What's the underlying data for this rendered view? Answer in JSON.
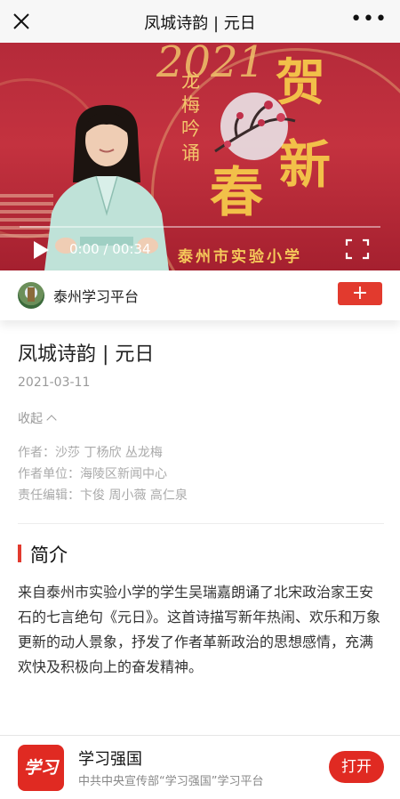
{
  "topbar": {
    "title": "凤城诗韵 | 元日",
    "close_icon": "close-icon",
    "more_icon": "more-icon",
    "more_glyph": "•••"
  },
  "video": {
    "banner_year": "2021",
    "banner_title": "龙梅吟诵",
    "banner_char_1": "贺",
    "banner_char_2": "新",
    "banner_char_3": "春",
    "banner_school": "泰州市实验小学",
    "time": "0:00 / 00:34",
    "progress": 0,
    "play_icon": "play-icon",
    "fullscreen_icon": "fullscreen-icon"
  },
  "channel": {
    "name": "泰州学习平台",
    "follow_label": "+",
    "avatar_icon": "channel-avatar"
  },
  "article": {
    "title": "凤城诗韵 | 元日",
    "date": "2021-03-11",
    "collapse_label": "收起",
    "author": "作者：沙莎 丁杨欣 丛龙梅",
    "author_unit": "作者单位：海陵区新闻中心",
    "editor": "责任编辑：卞俊 周小薇 高仁泉",
    "section_title": "简介",
    "intro": "来自泰州市实验小学的学生吴瑞嘉朗诵了北宋政治家王安石的七言绝句《元日》。这首诗描写新年热闹、欢乐和万象更新的动人景象，抒发了作者革新政治的思想感情，充满欢快及积极向上的奋发精神。"
  },
  "footer": {
    "app_logo_text": "学习",
    "app_name": "学习强国",
    "app_desc": "中共中央宣传部“学习强国”学习平台",
    "open_label": "打开"
  },
  "colors": {
    "accent": "#e23a2e",
    "banner_red": "#b52a3a",
    "banner_gold": "#f2c049"
  }
}
